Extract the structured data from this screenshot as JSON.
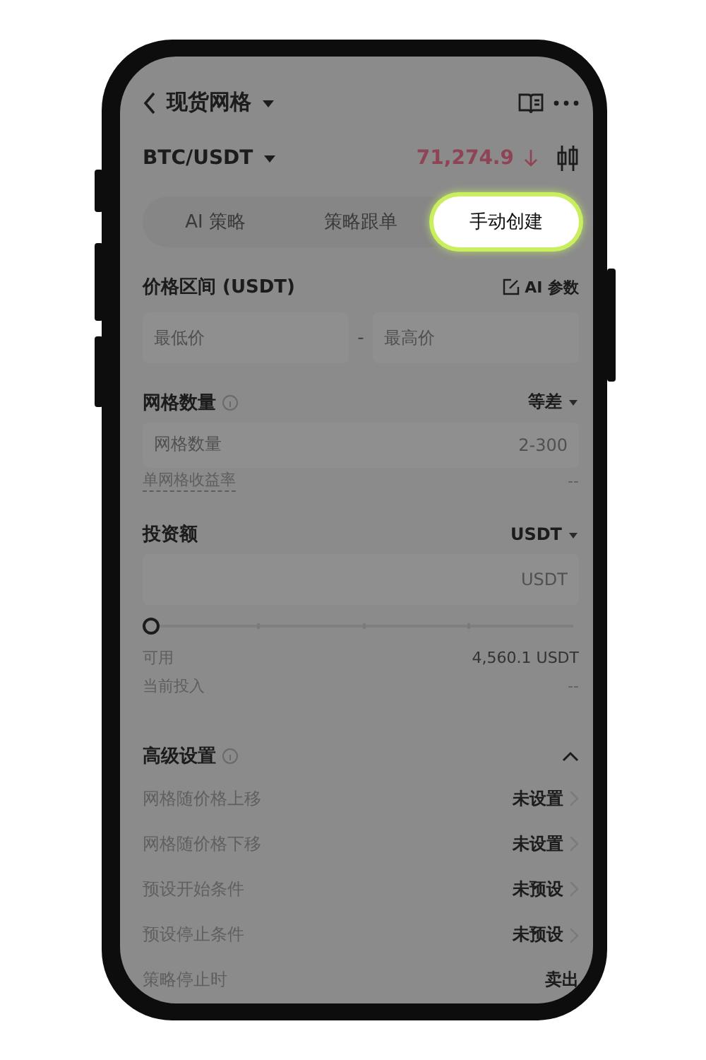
{
  "header": {
    "title": "现货网格"
  },
  "pair": {
    "symbol": "BTC/USDT",
    "price": "71,274.9"
  },
  "tabs": [
    {
      "label": "AI 策略",
      "selected": false
    },
    {
      "label": "策略跟单",
      "selected": false
    },
    {
      "label": "手动创建",
      "selected": true
    }
  ],
  "price_range": {
    "label": "价格区间 (USDT)",
    "ai_link": "AI 参数",
    "min_placeholder": "最低价",
    "separator": "-",
    "max_placeholder": "最高价"
  },
  "grid_count": {
    "label": "网格数量",
    "mode": "等差",
    "placeholder": "网格数量",
    "hint": "2-300",
    "yield_label": "单网格收益率",
    "yield_value": "--"
  },
  "investment": {
    "label": "投资额",
    "currency": "USDT",
    "placeholder": "USDT",
    "level": 0,
    "available_label": "可用",
    "available_value": "4,560.1 USDT",
    "current_label": "当前投入",
    "current_value": "--"
  },
  "advanced": {
    "label": "高级设置",
    "expanded": true,
    "rows": [
      {
        "label": "网格随价格上移",
        "value": "未设置",
        "chevron": true
      },
      {
        "label": "网格随价格下移",
        "value": "未设置",
        "chevron": true
      },
      {
        "label": "预设开始条件",
        "value": "未预设",
        "chevron": true
      },
      {
        "label": "预设停止条件",
        "value": "未预设",
        "chevron": true
      },
      {
        "label": "策略停止时",
        "value": "卖出",
        "chevron": false
      }
    ]
  }
}
